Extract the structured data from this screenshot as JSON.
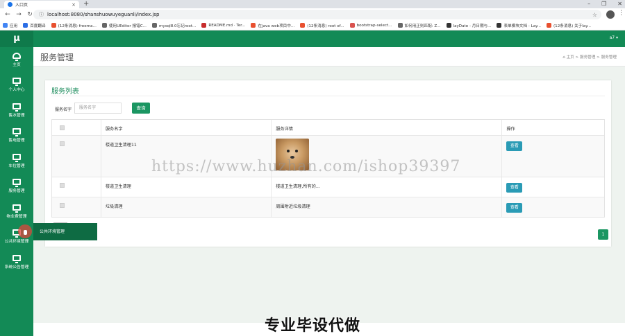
{
  "browser": {
    "tab_title": "入口页",
    "url": "localhost:8080/shanshuowuyeguanli/index.jsp",
    "bookmarks": [
      {
        "label": "应用",
        "color": "#4285f4"
      },
      {
        "label": "百度翻译",
        "color": "#2b6de5"
      },
      {
        "label": "(12条消息) freema...",
        "color": "#e8502f"
      },
      {
        "label": "使用UEditor 报错C...",
        "color": "#666666"
      },
      {
        "label": "mysql8.0忘记root...",
        "color": "#666666"
      },
      {
        "label": "README.md · Ter...",
        "color": "#c72c2c"
      },
      {
        "label": "在java web项目中...",
        "color": "#e8502f"
      },
      {
        "label": "(12条消息) root of...",
        "color": "#e8502f"
      },
      {
        "label": "bootstrap-select...",
        "color": "#d9534f"
      },
      {
        "label": "如何用正则匹配: Z...",
        "color": "#666666"
      },
      {
        "label": "layDate - 月日期与...",
        "color": "#333333"
      },
      {
        "label": "表单模块文档 - Lay...",
        "color": "#333333"
      },
      {
        "label": "(12条消息) 关于lay...",
        "color": "#e8502f"
      }
    ]
  },
  "sidebar": {
    "logo": "μ",
    "items": [
      {
        "label": "主页",
        "icon": "dashboard-icon"
      },
      {
        "label": "个人中心",
        "icon": "monitor-icon"
      },
      {
        "label": "售水管理",
        "icon": "monitor-icon"
      },
      {
        "label": "售电管理",
        "icon": "monitor-icon"
      },
      {
        "label": "车位管理",
        "icon": "monitor-icon"
      },
      {
        "label": "服务管理",
        "icon": "monitor-icon"
      },
      {
        "label": "物业费管理",
        "icon": "monitor-icon"
      },
      {
        "label": "公共环境管理",
        "icon": "monitor-icon"
      },
      {
        "label": "系统公告管理",
        "icon": "monitor-icon"
      }
    ]
  },
  "topbar": {
    "user": "a7 ▾"
  },
  "page": {
    "title": "服务管理",
    "breadcrumb": "主页  >  服务管理  >  服务管理"
  },
  "card": {
    "title": "服务列表",
    "search_label": "服务名字",
    "search_placeholder": "服务名字",
    "search_button": "查询",
    "headers": [
      "",
      "服务名字",
      "服务详情",
      "操作"
    ],
    "rows": [
      {
        "name": "楼道卫生清理11",
        "detail": "",
        "has_image": true,
        "action": "查看"
      },
      {
        "name": "楼道卫生清理",
        "detail": "楼道卫生清理,所有的...",
        "has_image": false,
        "action": "查看"
      },
      {
        "name": "垃圾清理",
        "detail": "周围附近垃圾清理",
        "has_image": false,
        "action": "查看"
      }
    ],
    "page_number": "1"
  },
  "tooltip": "公共环境管理",
  "overlay": {
    "watermark": "https://www.huzhan.com/ishop39397",
    "caption": "专业毕设代做"
  }
}
